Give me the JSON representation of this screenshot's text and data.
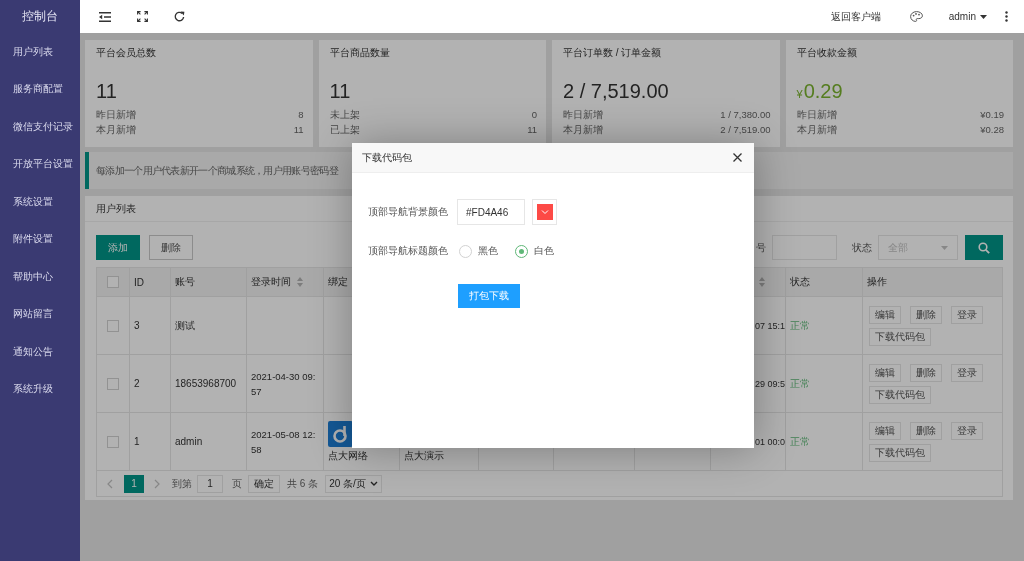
{
  "sidebar": {
    "title": "控制台",
    "items": [
      {
        "label": "用户列表",
        "selected": false
      },
      {
        "label": "服务商配置",
        "selected": false
      },
      {
        "label": "微信支付记录",
        "selected": false
      },
      {
        "label": "开放平台设置",
        "selected": false
      },
      {
        "label": "系统设置",
        "selected": false
      },
      {
        "label": "附件设置",
        "selected": false
      },
      {
        "label": "帮助中心",
        "selected": false
      },
      {
        "label": "网站留言",
        "selected": false
      },
      {
        "label": "通知公告",
        "selected": false
      },
      {
        "label": "系统升级",
        "selected": false
      }
    ]
  },
  "header": {
    "back_link": "返回客户端",
    "user": "admin"
  },
  "stats": [
    {
      "title": "平台会员总数",
      "value": "11",
      "highlighted": false,
      "rows": [
        {
          "label": "昨日新增",
          "value": "8"
        },
        {
          "label": "本月新增",
          "value": "11"
        }
      ]
    },
    {
      "title": "平台商品数量",
      "value": "11",
      "highlighted": false,
      "rows": [
        {
          "label": "未上架",
          "value": "0"
        },
        {
          "label": "已上架",
          "value": "11"
        }
      ]
    },
    {
      "title": "平台订单数 / 订单金额",
      "value": "2 / 7,519.00",
      "highlighted": false,
      "rows": [
        {
          "label": "昨日新增",
          "value": "1 / 7,380.00"
        },
        {
          "label": "本月新增",
          "value": "2 / 7,519.00"
        }
      ]
    },
    {
      "title": "平台收款金额",
      "currency": "¥",
      "value": "0.29",
      "highlighted": true,
      "rows": [
        {
          "label": "昨日新增",
          "value": "¥0.19"
        },
        {
          "label": "本月新增",
          "value": "¥0.28"
        }
      ]
    }
  ],
  "notice": "每添加一个用户代表新开一个商城系统，用户用账号密码登",
  "panel": {
    "title": "用户列表",
    "buttons": [
      {
        "label": "添加",
        "kind": "primary"
      },
      {
        "label": "删除",
        "kind": "plain"
      }
    ],
    "filters": [
      {
        "kind": "input",
        "label": "号"
      },
      {
        "kind": "select",
        "label": "状态",
        "placeholder": "全部"
      }
    ]
  },
  "table": {
    "select_all": {
      "checked": false
    },
    "columns": [
      {
        "label": "ID",
        "sortable": false
      },
      {
        "label": "账号",
        "sortable": false
      },
      {
        "label": "登录时间",
        "sortable": true
      },
      {
        "label": "绑定",
        "sortable": false
      },
      {
        "sortable": true
      },
      {
        "label": "状态",
        "sortable": false
      },
      {
        "label": "操作",
        "sortable": false
      }
    ],
    "rows": [
      {
        "checked": false,
        "id": "3",
        "account": "测试",
        "column_10": "07 15:1",
        "status": "正常",
        "actions": [
          "编辑",
          "删除",
          "登录",
          "下载代码包"
        ]
      },
      {
        "checked": false,
        "id": "2",
        "account": "18653968700",
        "login_time": "2021-04-30 09:57",
        "column_10": "29 09:5",
        "status": "正常",
        "actions": [
          "编辑",
          "删除",
          "登录",
          "下载代码包"
        ]
      },
      {
        "checked": false,
        "id": "1",
        "account": "admin",
        "login_time": "2021-05-08 12:58",
        "binding": {
          "logo": true,
          "name": "点大网络"
        },
        "column_6": "点大演示",
        "column_10": "01 00:0",
        "status": "正常",
        "actions": [
          "编辑",
          "删除",
          "登录",
          "下载代码包"
        ]
      }
    ]
  },
  "pagination": {
    "pages": [
      {
        "label": "1",
        "selected": true
      }
    ],
    "goto_label": "到第",
    "goto_value": "1",
    "page_label": "页",
    "confirm": "确定",
    "total": "共 6 条",
    "page_size": "20 条/页"
  },
  "modal": {
    "title": "下载代码包",
    "fields": [
      {
        "kind": "color",
        "label": "顶部导航背景颜色",
        "value": "#FD4A46",
        "color": "#fd4a46"
      },
      {
        "kind": "radio",
        "label": "顶部导航标题颜色",
        "options": [
          {
            "label": "黑色",
            "selected": false
          },
          {
            "label": "白色",
            "selected": true
          }
        ]
      }
    ],
    "submit": "打包下载"
  }
}
